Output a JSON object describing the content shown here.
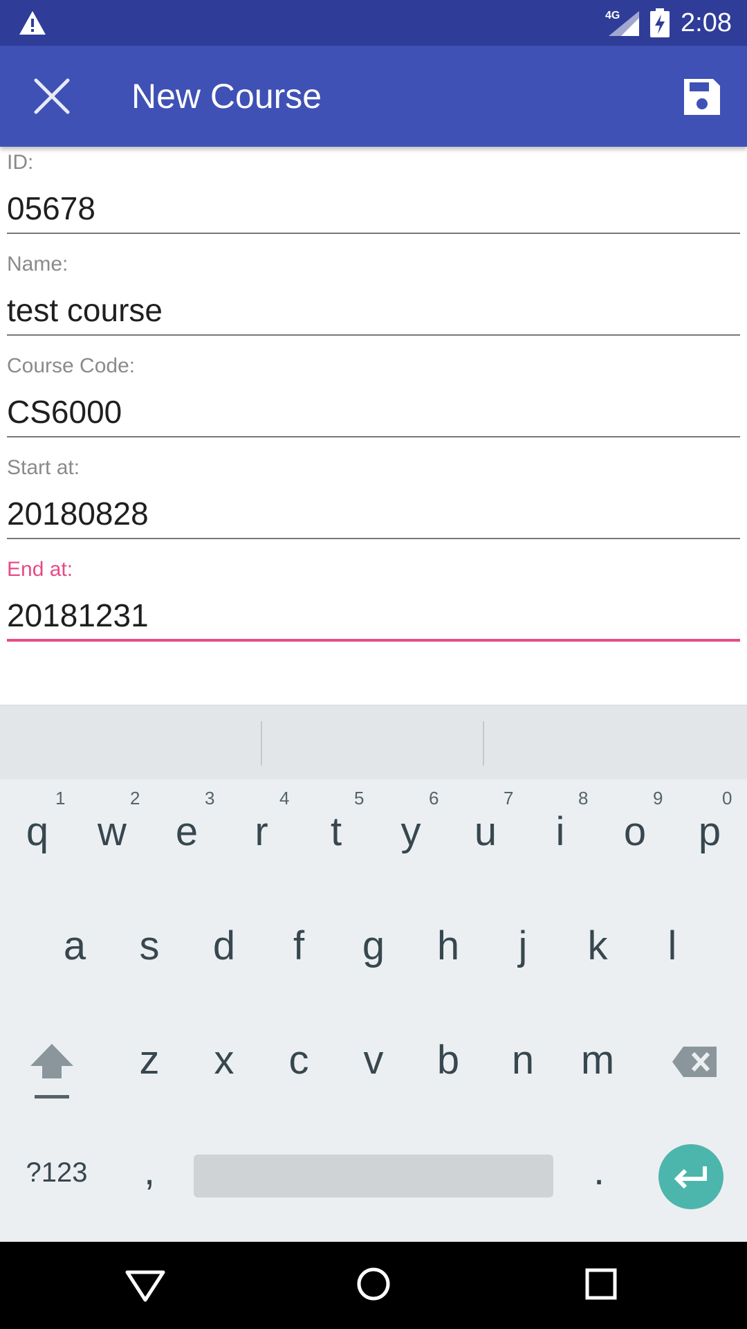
{
  "status_bar": {
    "network": "4G",
    "time": "2:08"
  },
  "app_bar": {
    "title": "New Course",
    "close_icon": "close-icon",
    "save_icon": "save-icon"
  },
  "form": {
    "fields": [
      {
        "label": "ID:",
        "value": "05678"
      },
      {
        "label": "Name:",
        "value": "test course"
      },
      {
        "label": "Course Code:",
        "value": "CS6000"
      },
      {
        "label": "Start at:",
        "value": "20180828"
      },
      {
        "label": "End at:",
        "value": "20181231"
      }
    ]
  },
  "keyboard": {
    "row1": [
      {
        "key": "q",
        "hint": "1"
      },
      {
        "key": "w",
        "hint": "2"
      },
      {
        "key": "e",
        "hint": "3"
      },
      {
        "key": "r",
        "hint": "4"
      },
      {
        "key": "t",
        "hint": "5"
      },
      {
        "key": "y",
        "hint": "6"
      },
      {
        "key": "u",
        "hint": "7"
      },
      {
        "key": "i",
        "hint": "8"
      },
      {
        "key": "o",
        "hint": "9"
      },
      {
        "key": "p",
        "hint": "0"
      }
    ],
    "row2": [
      "a",
      "s",
      "d",
      "f",
      "g",
      "h",
      "j",
      "k",
      "l"
    ],
    "row3": [
      "z",
      "x",
      "c",
      "v",
      "b",
      "n",
      "m"
    ],
    "symbols_key": "?123",
    "comma_key": ",",
    "period_key": "."
  },
  "colors": {
    "status_bar": "#2f3d99",
    "app_bar": "#3f51b5",
    "accent": "#e84a87",
    "enter_key": "#4db6ac"
  }
}
